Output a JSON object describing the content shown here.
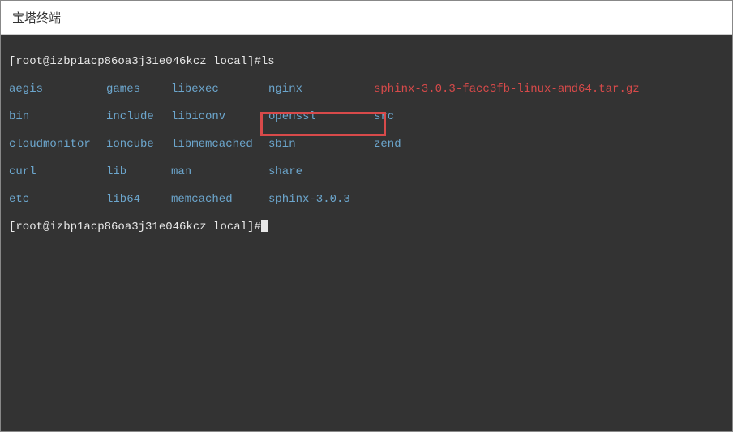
{
  "titlebar": {
    "title": "宝塔终端"
  },
  "terminal": {
    "prompt": "[root@izbp1acp86oa3j31e046kcz local]#",
    "command": "ls",
    "listing": {
      "rows": [
        {
          "c1": "aegis",
          "c2": "games",
          "c3": "libexec",
          "c4": "nginx",
          "c5": "sphinx-3.0.3-facc3fb-linux-amd64.tar.gz",
          "c5_type": "file-red"
        },
        {
          "c1": "bin",
          "c2": "include",
          "c3": "libiconv",
          "c4": "openssl",
          "c5": "src",
          "c5_type": "dir"
        },
        {
          "c1": "cloudmonitor",
          "c2": "ioncube",
          "c3": "libmemcached",
          "c4": "sbin",
          "c5": "zend",
          "c5_type": "dir"
        },
        {
          "c1": "curl",
          "c2": "lib",
          "c3": "man",
          "c4": "share",
          "c5": "",
          "c5_type": "dir"
        },
        {
          "c1": "etc",
          "c2": "lib64",
          "c3": "memcached",
          "c4": "sphinx-3.0.3",
          "c5": "",
          "c5_type": "dir"
        }
      ]
    },
    "prompt2": "[root@izbp1acp86oa3j31e046kcz local]#"
  }
}
